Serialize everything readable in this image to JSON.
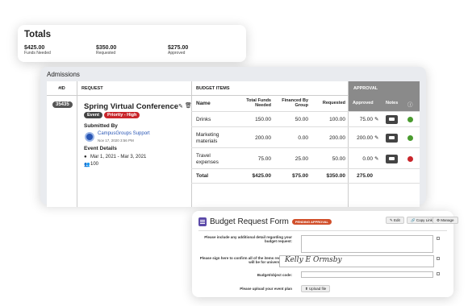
{
  "totals": {
    "title": "Totals",
    "items": [
      {
        "value": "$425.00",
        "label": "Funds Needed"
      },
      {
        "value": "$350.00",
        "label": "Requested"
      },
      {
        "value": "$275.00",
        "label": "Approved"
      }
    ]
  },
  "admissions": {
    "title": "Admissions",
    "headers": {
      "id": "#ID",
      "request": "REQUEST",
      "budget_items": "BUDGET ITEMS",
      "approval": "APPROVAL"
    },
    "subheaders": {
      "name": "Name",
      "total_funds_needed": "Total Funds Needed",
      "financed_by_group": "Financed By Group",
      "requested": "Requested",
      "approved": "Approved",
      "notes": "Notes"
    },
    "request": {
      "id": "35435",
      "title": "Spring Virtual Conference",
      "tags": [
        "Event",
        "Priority - High"
      ],
      "submitted_by_label": "Submitted By",
      "submitter": "CampusGroups Support",
      "submitted_date": "Nov 17, 2020 3:56 PM",
      "event_details_label": "Event Details",
      "event_dates": "Mar 1, 2021 - Mar 3, 2021",
      "attendees": "100"
    },
    "rows": [
      {
        "name": "Drinks",
        "total": "150.00",
        "financed": "50.00",
        "requested": "100.00",
        "approved": "75.00",
        "status": "#4a9b2f"
      },
      {
        "name": "Marketing materials",
        "total": "200.00",
        "financed": "0.00",
        "requested": "200.00",
        "approved": "200.00",
        "status": "#4a9b2f"
      },
      {
        "name": "Travel expenses",
        "total": "75.00",
        "financed": "25.00",
        "requested": "50.00",
        "approved": "0.00",
        "status": "#c9262b"
      }
    ],
    "total_row": {
      "label": "Total",
      "total": "$425.00",
      "financed": "$75.00",
      "requested": "$350.00",
      "approved": "275.00"
    }
  },
  "budget_form": {
    "title": "Budget Request Form",
    "status": "PENDING APPROVAL",
    "buttons": {
      "edit": "Edit",
      "copy_link": "Copy Link",
      "manage": "Manage"
    },
    "fields": [
      {
        "label": "Please include any additional detail regarding your budget request:"
      },
      {
        "label": "Please sign here to confirm all of the items requested will be for university use.",
        "value": "Kelly E Ormsby"
      },
      {
        "label": "Budget/object code:"
      },
      {
        "label": "Please upload your event plan",
        "button": "Upload file"
      }
    ]
  },
  "colors": {
    "approval_header": "#8a8a8a",
    "priority": "#c9262b",
    "event_tag": "#444444",
    "pending": "#d14f2a",
    "link": "#2a57b5"
  }
}
